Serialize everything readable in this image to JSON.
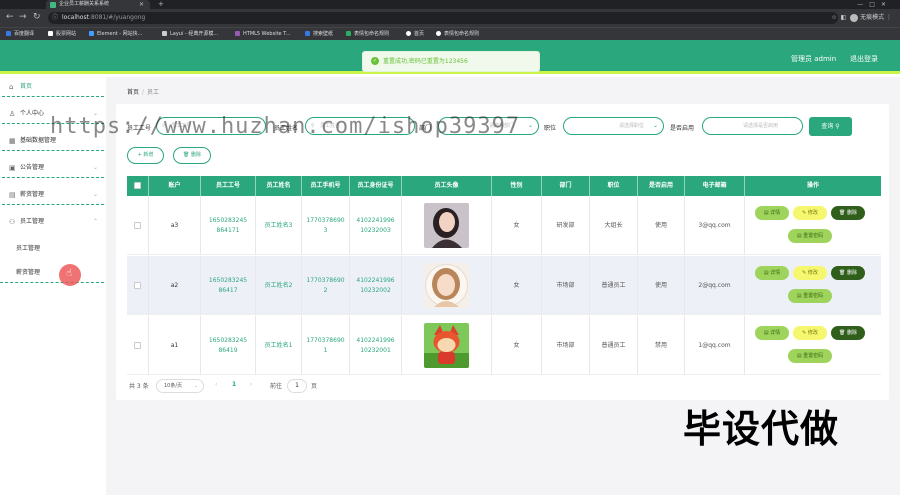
{
  "browser": {
    "tab_title": "企业员工薪酬关系系统",
    "url_host": "localhost",
    "url_path": ":8081/#/yuangong",
    "profile_label": "无痕模式",
    "bookmarks": [
      "百度翻译",
      "股票网站",
      "Element - 网站快...",
      "Layui - 经典开源模...",
      "HTML5 Website T...",
      "搜索壁纸",
      "表情包命名规则",
      "首页",
      "表情包命名规则"
    ]
  },
  "header": {
    "user_label": "管理员 admin",
    "logout_label": "退出登录"
  },
  "toast": {
    "message": "重置成功,密码已重置为123456"
  },
  "sidebar": {
    "items": [
      {
        "label": "首页",
        "icon": "home-icon"
      },
      {
        "label": "个人中心",
        "icon": "user-icon"
      },
      {
        "label": "基础数据管理",
        "icon": "grid-icon"
      },
      {
        "label": "公告管理",
        "icon": "notice-icon"
      },
      {
        "label": "薪资管理",
        "icon": "money-icon"
      },
      {
        "label": "员工管理",
        "icon": "team-icon"
      }
    ],
    "subitems": [
      "员工管理",
      "薪资管理"
    ]
  },
  "breadcrumb": {
    "home": "首页",
    "separator": "/",
    "current": "员工"
  },
  "search": {
    "employee_no_label": "员工工号",
    "employee_no_placeholder": "员工工号",
    "employee_name_label": "员工姓名",
    "employee_name_placeholder": "员工姓名",
    "department_label": "部门",
    "department_placeholder": "请选择部门",
    "position_label": "职位",
    "position_placeholder": "请选择职位",
    "enabled_label": "是否启用",
    "enabled_placeholder": "请选择是否启用",
    "search_button": "查询"
  },
  "toolbar": {
    "add_label": "+ 新增",
    "delete_label": "删除"
  },
  "table": {
    "columns": [
      "账户",
      "员工工号",
      "员工姓名",
      "员工手机号",
      "员工身份证号",
      "员工头像",
      "性别",
      "部门",
      "职位",
      "是否启用",
      "电子邮箱",
      "操作"
    ],
    "rows": [
      {
        "account": "a3",
        "emp_no": "1650283245 864171",
        "name": "员工姓名3",
        "phone": "1770378690 3",
        "id_card": "4102241996 10232003",
        "gender": "女",
        "dept": "研发部",
        "position": "大组长",
        "enabled": "使用",
        "email": "3@qq.com"
      },
      {
        "account": "a2",
        "emp_no": "1650283245 86417",
        "name": "员工姓名2",
        "phone": "1770378690 2",
        "id_card": "4102241996 10232002",
        "gender": "女",
        "dept": "市场部",
        "position": "普通员工",
        "enabled": "使用",
        "email": "2@qq.com"
      },
      {
        "account": "a1",
        "emp_no": "1650283245 86419",
        "name": "员工姓名1",
        "phone": "1770378690 1",
        "id_card": "4102241996 10232001",
        "gender": "女",
        "dept": "市场部",
        "position": "普通员工",
        "enabled": "禁用",
        "email": "1@qq.com"
      }
    ],
    "actions": {
      "detail": "详情",
      "edit": "修改",
      "delete": "删除",
      "reset": "重置密码"
    }
  },
  "pagination": {
    "total": "共 3 条",
    "page_size": "10条/页",
    "current_page": "1",
    "goto_label": "前往",
    "goto_value": "1",
    "page_suffix": "页"
  },
  "overlay": {
    "watermark": "https://www.huzhan.com/ishop39397",
    "stamp": "毕设代做"
  }
}
